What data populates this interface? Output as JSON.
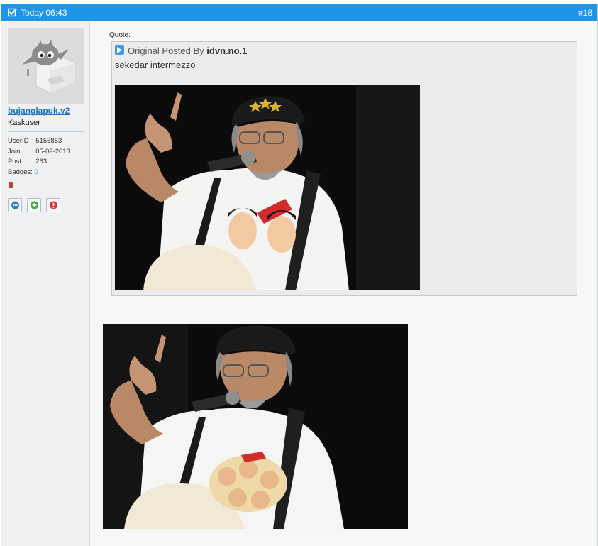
{
  "header": {
    "date": "Today 06:43",
    "post_number": "#18",
    "color": "#1e95e6"
  },
  "user": {
    "username": "bujanglapuk.v2",
    "rank": "Kaskuser",
    "stats": [
      {
        "key": "UserID",
        "value": ": 5155853"
      },
      {
        "key": "Join",
        "value": ": 05-02-2013"
      },
      {
        "key": "Post",
        "value": ": 263"
      }
    ],
    "badges_label": "Badges: ",
    "badges_value": "0",
    "avatar_icon": "kaskus-guest-avatar",
    "actions": [
      {
        "name": "send-message-button",
        "icon": "chat-bubble-icon",
        "color": "#2a7fd4"
      },
      {
        "name": "add-reputation-button",
        "icon": "plus-bubble-icon",
        "color": "#3aa845"
      },
      {
        "name": "report-button",
        "icon": "alert-icon",
        "color": "#d23a3a"
      }
    ]
  },
  "post": {
    "quote_label": "Quote:",
    "quote_by_prefix": "Original Posted By",
    "quote_author": "idvn.no.1",
    "quote_text": "sekedar intermezzo",
    "images": [
      "singer-with-guitar-photo-1",
      "singer-with-guitar-photo-2"
    ]
  }
}
